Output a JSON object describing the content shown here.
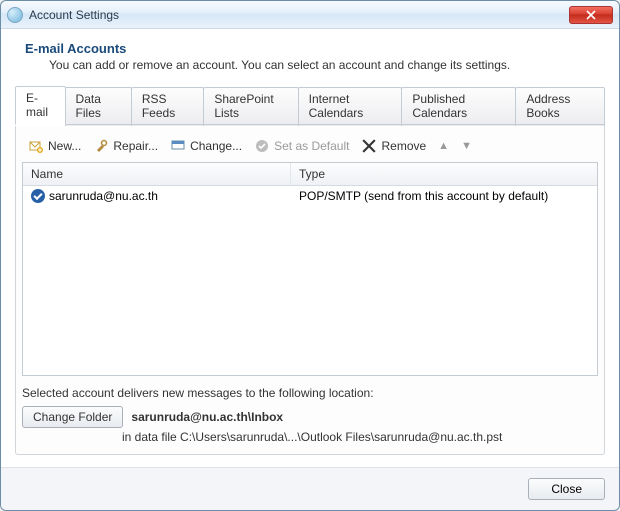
{
  "window": {
    "title": "Account Settings"
  },
  "header": {
    "title": "E-mail Accounts",
    "desc": "You can add or remove an account. You can select an account and change its settings."
  },
  "tabs": [
    {
      "label": "E-mail",
      "active": true
    },
    {
      "label": "Data Files"
    },
    {
      "label": "RSS Feeds"
    },
    {
      "label": "SharePoint Lists"
    },
    {
      "label": "Internet Calendars"
    },
    {
      "label": "Published Calendars"
    },
    {
      "label": "Address Books"
    }
  ],
  "toolbar": {
    "new": "New...",
    "repair": "Repair...",
    "change": "Change...",
    "setdefault": "Set as Default",
    "remove": "Remove"
  },
  "columns": {
    "name": "Name",
    "type": "Type"
  },
  "accounts": [
    {
      "name": "sarunruda@nu.ac.th",
      "type": "POP/SMTP (send from this account by default)",
      "isDefault": true
    }
  ],
  "delivery": {
    "label": "Selected account delivers new messages to the following location:",
    "changeFolder": "Change Folder",
    "target": "sarunruda@nu.ac.th\\Inbox",
    "path": "in data file C:\\Users\\sarunruda\\...\\Outlook Files\\sarunruda@nu.ac.th.pst"
  },
  "footer": {
    "close": "Close"
  }
}
